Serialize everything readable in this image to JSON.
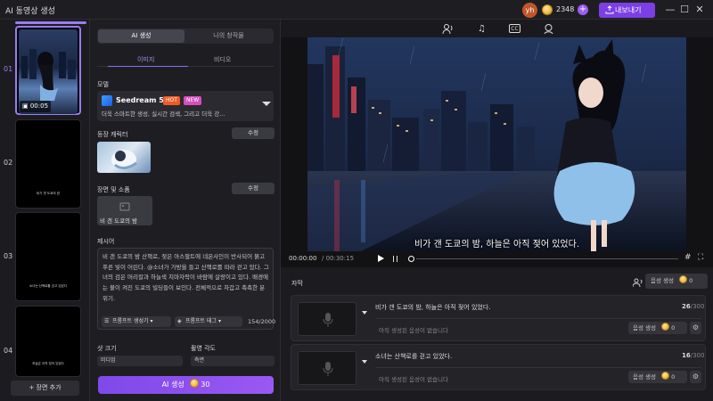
{
  "app": {
    "title": "AI 동영상 생성"
  },
  "header": {
    "avatar_initials": "yh",
    "credits": "2348",
    "plus": "+",
    "export_label": "내보내기"
  },
  "window_controls": {
    "minimize": "—",
    "maximize": "☐",
    "close": "✕"
  },
  "scenes": [
    {
      "number": "01",
      "duration": "00:05",
      "selected": true
    },
    {
      "number": "02",
      "caption": "비가 갠 도쿄의 밤"
    },
    {
      "number": "03",
      "caption": "소녀는 산책로를 걷고 있었다"
    },
    {
      "number": "04",
      "caption": "하늘은 아직 젖어 있었다"
    }
  ],
  "scene_panel": {
    "add_scene_label": "+ 장면 추가"
  },
  "settings": {
    "tabs": [
      "AI 생성",
      "나의 창작물"
    ],
    "subtabs": [
      "이미지",
      "비디오"
    ],
    "model_label": "모델",
    "model_name": "Seedream 5.0",
    "model_badge_hot": "HOT",
    "model_badge_new": "NEW",
    "model_desc": "더욱 스마트한 생성, 실시간 검색, 그리고 더욱 강...",
    "character_label": "등장 캐릭터",
    "edit_label": "수정",
    "scene_prop_label": "장면 및 소품",
    "scene_chip": "비 갠 도쿄의 밤",
    "prompt_label": "제시어",
    "prompt_text": "비 갠 도쿄의 밤 산책로, 젖은 아스팔트에 네온사인이 반사되어 붉고 푸른 빛이 어린다. @소녀가 가방을 들고 산책로를 따라 걷고 있다. 그녀의 검은 머리칼과 하늘색 치마자락이 바람에 살랑이고 있다. 배경에는 불이 켜진 도쿄의 빌딩들이 보인다. 전체적으로 차갑고 촉촉한 분위기.",
    "gen_prompt_label": "프롬프트 생성기",
    "prompt_tag_label": "프롬프트 태그",
    "char_count": "154/2000",
    "shot_size_label": "샷 크기",
    "shot_size_value": "미디엄",
    "angle_label": "촬영 각도",
    "angle_value": "측면",
    "ai_gen_label": "AI 생성",
    "ai_gen_cost": "30"
  },
  "preview": {
    "toolbar_icons": [
      "voice-icon",
      "music-icon",
      "caption-icon",
      "avatar-icon"
    ],
    "cc_label": "CC",
    "subtitle": "비가 갠 도쿄의 밤, 하늘은 아직 젖어 있었다.",
    "time_current": "00:00:00",
    "time_total": "/ 00:30:15"
  },
  "subtitles_panel": {
    "title": "자막",
    "voice_gen_label": "음성 생성",
    "voice_gen_cost": "0",
    "cards": [
      {
        "text": "비가 갠 도쿄의 밤, 하늘은 아직 젖어 있었다.",
        "count": "26",
        "max": "/300",
        "empty": "아직 생성된 음성이 없습니다",
        "vgen": "음성 생성",
        "cost": "0"
      },
      {
        "text": "소녀는 산책로를 걷고 있었다.",
        "count": "16",
        "max": "/300",
        "empty": "아직 생성된 음성이 없습니다",
        "vgen": "음성 생성",
        "cost": "0"
      }
    ]
  },
  "colors": {
    "accent": "#7b3fe4",
    "selected": "#9b7bf0",
    "hot": "#ee5a24",
    "new": "#d64dbb"
  }
}
